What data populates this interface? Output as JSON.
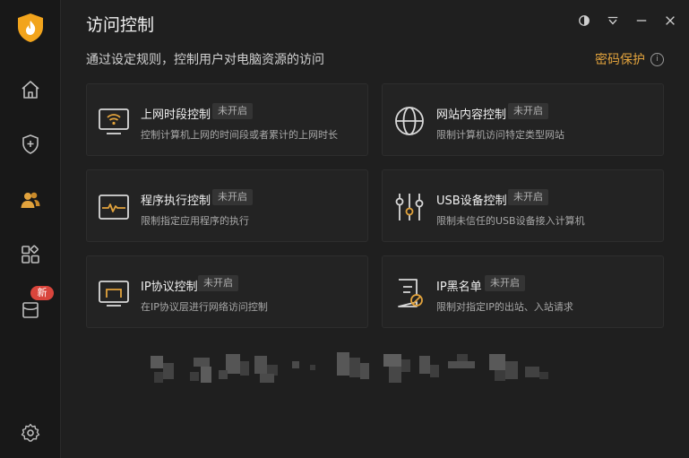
{
  "app": {
    "title": "访问控制",
    "subtitle": "通过设定规则，控制用户对电脑资源的访问",
    "password_link": "密码保护",
    "info_glyph": "i"
  },
  "sidebar": {
    "items": [
      {
        "name": "home-icon"
      },
      {
        "name": "shield-plus-icon"
      },
      {
        "name": "users-icon",
        "active": true
      },
      {
        "name": "apps-icon"
      },
      {
        "name": "toolbox-icon",
        "badge": "新"
      },
      {
        "name": "settings-icon"
      }
    ]
  },
  "window_controls": [
    "theme-icon",
    "menu-icon",
    "minimize-icon",
    "close-icon"
  ],
  "cards": [
    {
      "name": "上网时段控制",
      "status": "未开启",
      "desc": "控制计算机上网的时间段或者累计的上网时长",
      "icon": "wifi-monitor-icon"
    },
    {
      "name": "网站内容控制",
      "status": "未开启",
      "desc": "限制计算机访问特定类型网站",
      "icon": "globe-icon"
    },
    {
      "name": "程序执行控制",
      "status": "未开启",
      "desc": "限制指定应用程序的执行",
      "icon": "pulse-window-icon"
    },
    {
      "name": "USB设备控制",
      "status": "未开启",
      "desc": "限制未信任的USB设备接入计算机",
      "icon": "sliders-icon"
    },
    {
      "name": "IP协议控制",
      "status": "未开启",
      "desc": "在IP协议层进行网络访问控制",
      "icon": "monitor-icon"
    },
    {
      "name": "IP黑名单",
      "status": "未开启",
      "desc": "限制对指定IP的出站、入站请求",
      "icon": "blocked-doc-icon"
    }
  ],
  "colors": {
    "accent": "#e2a33d",
    "background": "#1f1f1f",
    "sidebar": "#181818",
    "card": "#232323",
    "badge": "#d9453c"
  }
}
